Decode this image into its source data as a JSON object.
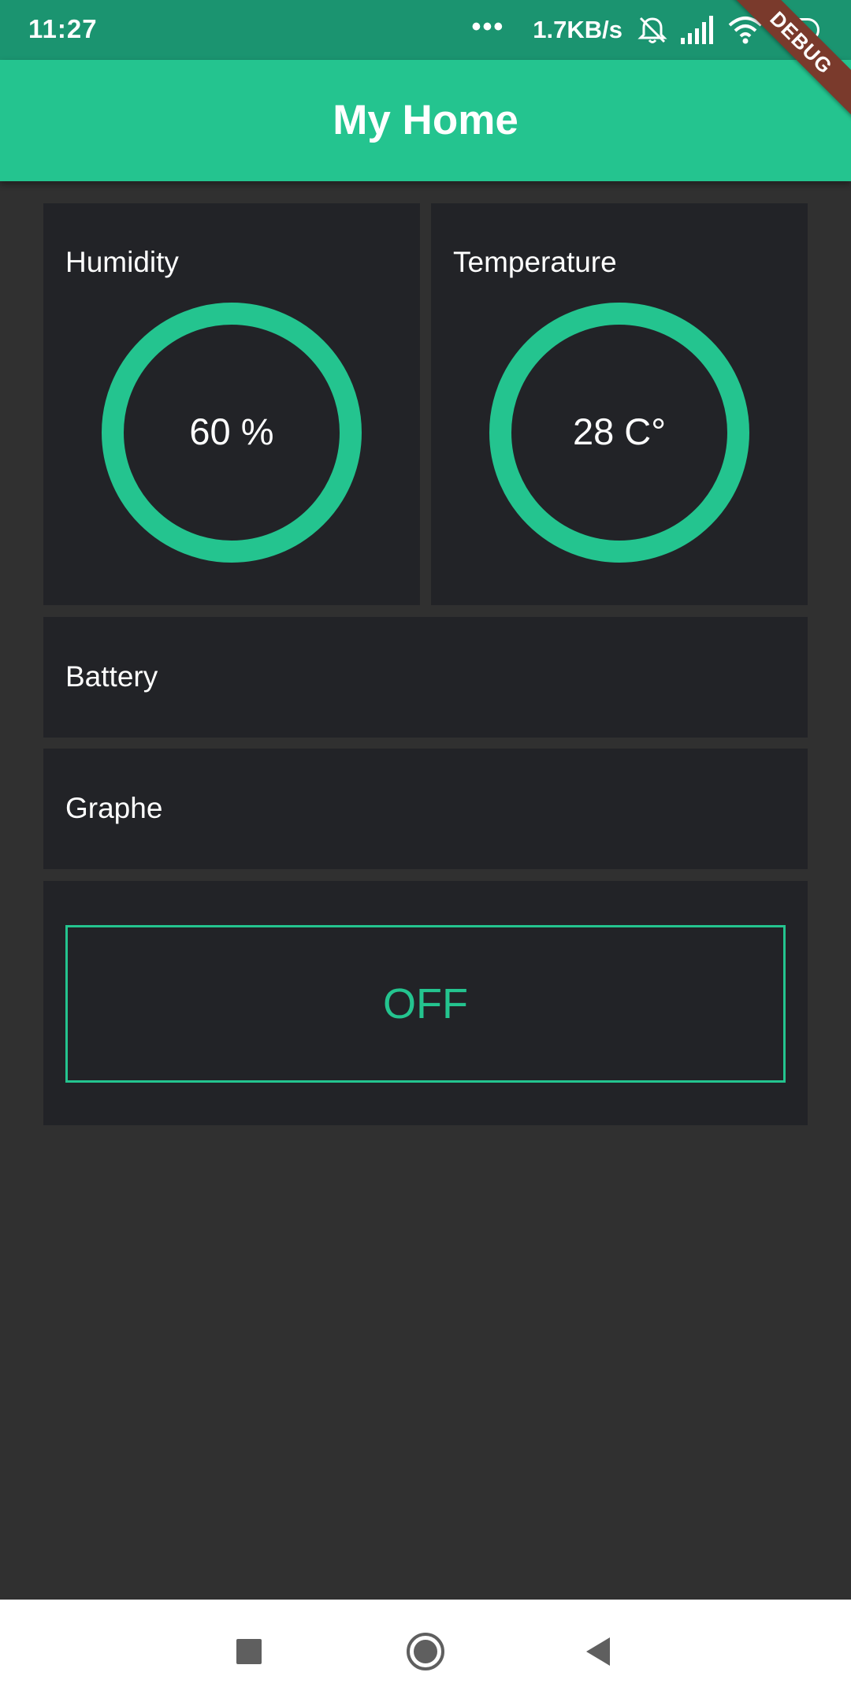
{
  "status_bar": {
    "time": "11:27",
    "dots": "•••",
    "speed": "1.7KB/s",
    "battery": "81",
    "icons": [
      "alarm-off-icon",
      "signal-icon",
      "wifi-icon",
      "battery-icon"
    ]
  },
  "app_bar": {
    "title": "My Home"
  },
  "debug_banner": "DEBUG",
  "humidity": {
    "label": "Humidity",
    "value": "60 %"
  },
  "temperature": {
    "label": "Temperature",
    "value": "28 C°"
  },
  "battery_card": {
    "label": "Battery"
  },
  "graph_card": {
    "label": "Graphe"
  },
  "toggle": {
    "label": "OFF"
  },
  "colors": {
    "accent": "#24c48f",
    "status_bar": "#1b9470",
    "background": "#303030",
    "card": "#222327",
    "debug": "#7a3a2c"
  },
  "nav": {
    "icons": [
      "recents-icon",
      "home-icon",
      "back-icon"
    ]
  }
}
